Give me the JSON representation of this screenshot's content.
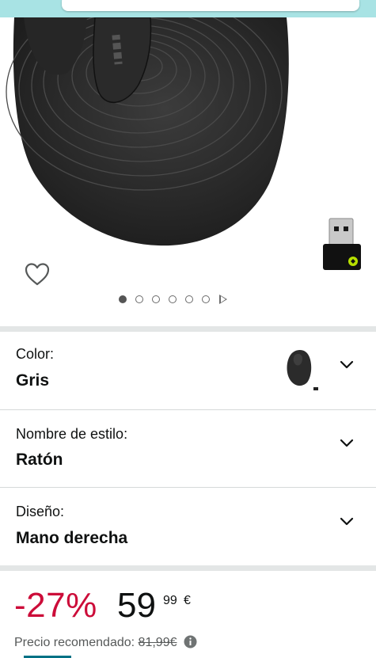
{
  "colors": {
    "discount": "#cc0c39",
    "topbar": "#a8e3e4",
    "separator": "#e3e6e6"
  },
  "gallery": {
    "image_icon": "mouse-product-image",
    "wishlist_icon": "heart-icon",
    "dongle_icon": "usb-receiver-image",
    "dots_total": 6,
    "dots_active_index": 0,
    "next_icon": "play-triangle-icon"
  },
  "options": [
    {
      "label": "Color:",
      "value": "Gris"
    },
    {
      "label": "Nombre de estilo:",
      "value": "Ratón"
    },
    {
      "label": "Diseño:",
      "value": "Mano derecha"
    }
  ],
  "price": {
    "discount": "-27%",
    "whole": "59",
    "fraction": "99",
    "currency": "€",
    "recommended_label": "Precio recomendado:",
    "recommended_value": "81,99€"
  }
}
